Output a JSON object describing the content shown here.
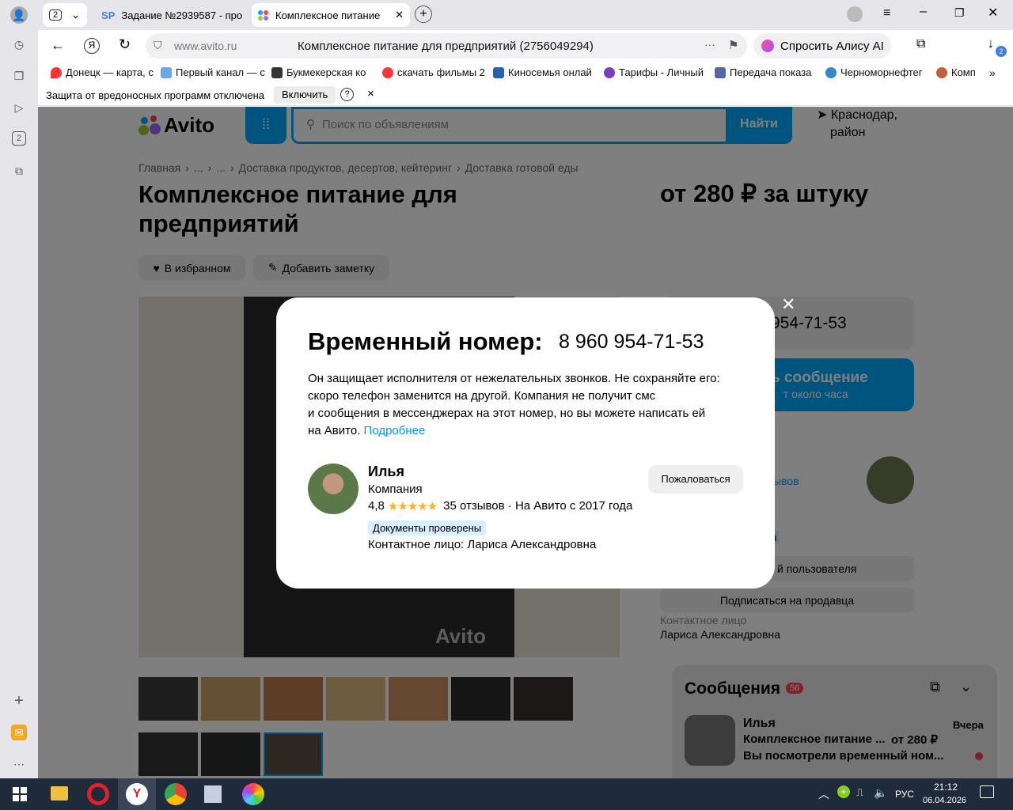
{
  "browser": {
    "tab_count": "2",
    "tabs": [
      {
        "label": "Задание №2939587 - про"
      },
      {
        "label": "Комплексное питание"
      }
    ],
    "address": {
      "domain": "www.avito.ru",
      "page_title": "Комплексное питание для предприятий (2756049294)"
    },
    "alice_label": "Спросить Алису AI",
    "downloads_badge": "2",
    "sidebar_badge": "2",
    "bookmarks": [
      "Донецк — карта, с",
      "Первый канал — с",
      "Букмекерская ко",
      "скачать фильмы 2",
      "Киносемья онлай",
      "Тарифы - Личный",
      "Передача показа",
      "Черноморнефтег",
      "Комп"
    ],
    "infobar": {
      "text": "Защита от вредоносных программ отключена",
      "button": "Включить",
      "help": "?",
      "close": "×"
    }
  },
  "page": {
    "logo": "Avito",
    "search_placeholder": "Поиск по объявлениям",
    "search_button": "Найти",
    "location": {
      "line1": "Краснодар,",
      "line2": "район"
    },
    "breadcrumb": [
      "Главная",
      "...",
      "...",
      "Доставка продуктов, десертов, кейтеринг",
      "Доставка готовой еды"
    ],
    "title": {
      "line1": "Комплексное питание для",
      "line2": "предприятий"
    },
    "price": "от 280 ₽ за штуку",
    "fav_button": "В избранном",
    "note_button": "Добавить заметку",
    "phone_partial": "954-71-53",
    "message_partial": {
      "title": "ь сообщение",
      "sub": "т около часа"
    },
    "reviews_partial": "ывов",
    "badge_partial": "ы",
    "user_partial": "й пользователя",
    "subscribe_button": "Подписаться на продавца",
    "contact_label": "Контактное лицо",
    "contact_name": "Лариса Александровна",
    "watermark": "Avito"
  },
  "modal": {
    "title": "Временный номер:",
    "phone": "8 960 954-71-53",
    "desc_lines": [
      "Он защищает исполнителя от нежелательных звонков. Не сохраняйте его:",
      "скоро телефон заменится на другой. Компания не получит смс",
      "и сообщения в мессенджерах на этот номер, но вы можете написать ей"
    ],
    "desc_last": "на Авито.",
    "more_link": "Подробнее",
    "seller_name": "Илья",
    "seller_type": "Компания",
    "rating": "4,8",
    "stars": "★★★★★",
    "reviews": "35 отзывов · На Авито с 2017 года",
    "verified": "Документы проверены",
    "contact": "Контактное лицо: Лариса Александровна",
    "report_button": "Пожаловаться",
    "close": "✕"
  },
  "messages": {
    "title": "Сообщения",
    "badge": "56",
    "item": {
      "name": "Илья",
      "time": "Вчера",
      "subject": "Комплексное питание ...",
      "price": "от 280 ₽",
      "preview": "Вы посмотрели временный ном..."
    }
  },
  "taskbar": {
    "lang": "РУС",
    "time": "21:12",
    "date": "06.04.2026"
  },
  "colors": {
    "avito_blue": "#00aaff",
    "link": "#0099f7",
    "badge_red": "#ff4053",
    "star": "#ffb021",
    "verified_bg": "#d8eefe"
  }
}
